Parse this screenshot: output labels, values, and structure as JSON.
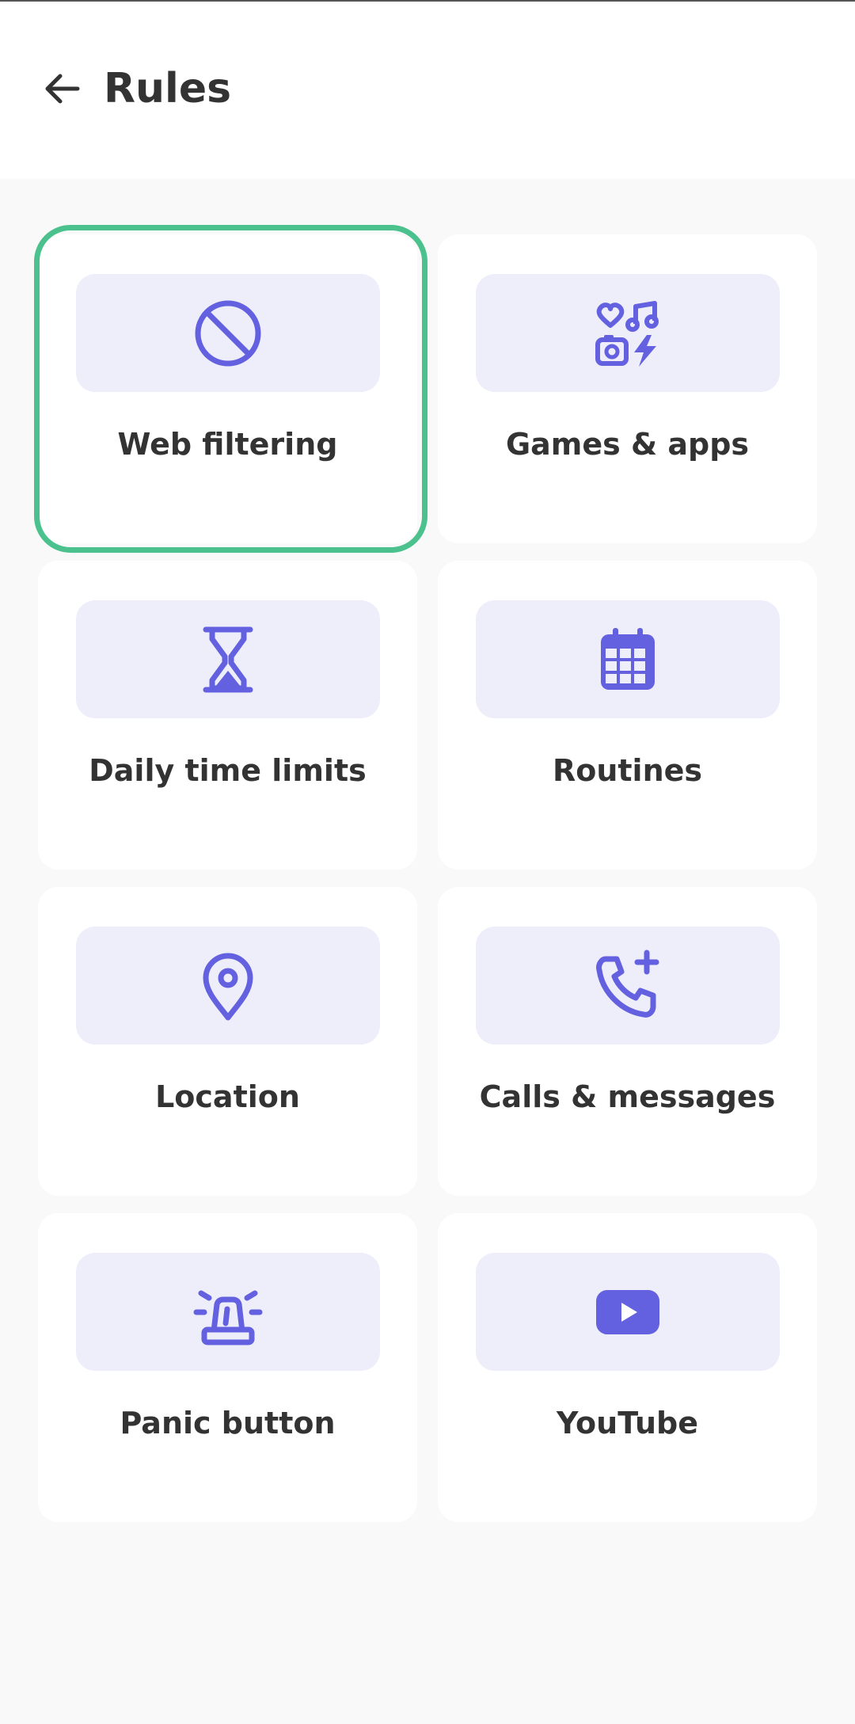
{
  "header": {
    "back_icon": "arrow-left-icon",
    "title": "Rules"
  },
  "colors": {
    "accent": "#6461e0",
    "icon_bg": "#eeeefb",
    "selected_border": "#4bc28e",
    "text": "#333333"
  },
  "rules": [
    {
      "label": "Web filtering",
      "icon": "block-icon",
      "selected": true
    },
    {
      "label": "Games & apps",
      "icon": "games-apps-icon",
      "selected": false
    },
    {
      "label": "Daily time limits",
      "icon": "hourglass-icon",
      "selected": false
    },
    {
      "label": "Routines",
      "icon": "calendar-icon",
      "selected": false
    },
    {
      "label": "Location",
      "icon": "location-pin-icon",
      "selected": false
    },
    {
      "label": "Calls & messages",
      "icon": "phone-plus-icon",
      "selected": false
    },
    {
      "label": "Panic button",
      "icon": "siren-icon",
      "selected": false
    },
    {
      "label": "YouTube",
      "icon": "youtube-icon",
      "selected": false
    }
  ]
}
